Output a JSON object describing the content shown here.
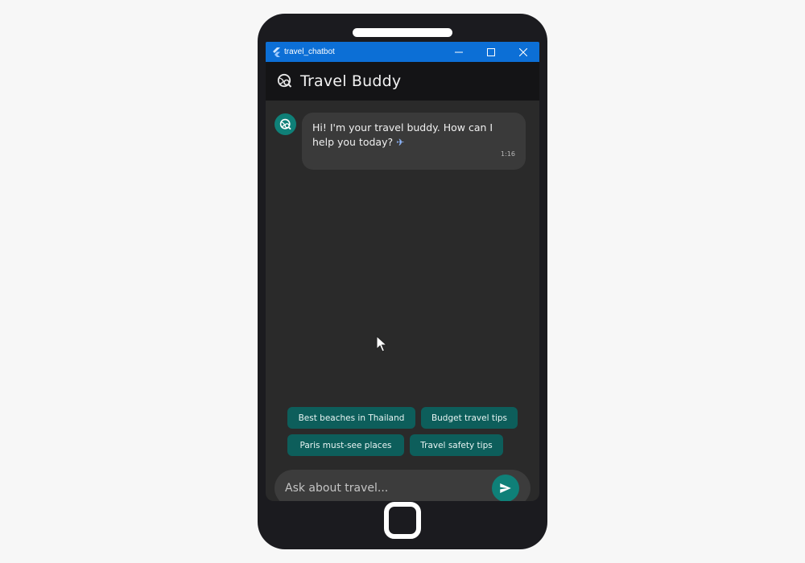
{
  "window": {
    "title": "travel_chatbot",
    "controls": [
      "minimize",
      "maximize",
      "close"
    ]
  },
  "appbar": {
    "title": "Travel Buddy",
    "logo_icon": "travel-explore-icon"
  },
  "messages": [
    {
      "sender": "bot",
      "text": "Hi! I'm your travel buddy. How can I help you today?",
      "emoji": "✈",
      "time": "1:16"
    }
  ],
  "suggestions": [
    "Best beaches in Thailand",
    "Budget travel tips",
    "Paris must-see places",
    "Travel safety tips"
  ],
  "input": {
    "placeholder": "Ask about travel...",
    "value": ""
  },
  "colors": {
    "accent": "#0f8078",
    "chip": "#0d5e5b",
    "titlebar": "#0c6fd6",
    "background": "#2a2a2a"
  }
}
